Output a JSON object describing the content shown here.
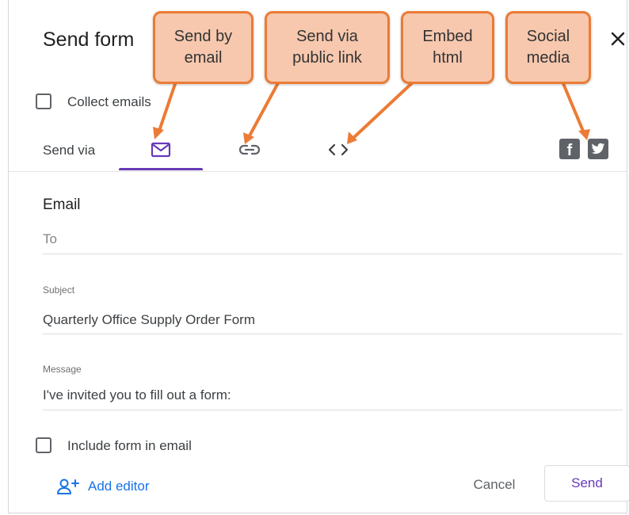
{
  "dialog": {
    "title": "Send form",
    "collect_emails": {
      "label": "Collect emails",
      "checked": false
    },
    "send_via": {
      "label": "Send via",
      "active_tab": "email",
      "active_color": "#673ab7",
      "tabs": [
        {
          "id": "email",
          "icon": "mail-icon"
        },
        {
          "id": "link",
          "icon": "link-icon"
        },
        {
          "id": "embed",
          "icon": "code-icon"
        }
      ],
      "social": [
        {
          "id": "facebook",
          "icon": "facebook-icon",
          "glyph": "f"
        },
        {
          "id": "twitter",
          "icon": "twitter-icon"
        }
      ]
    },
    "email_section": {
      "title": "Email",
      "to": {
        "placeholder": "To",
        "value": ""
      },
      "subject": {
        "label": "Subject",
        "value": "Quarterly Office Supply Order Form"
      },
      "message": {
        "label": "Message",
        "value": "I've invited you to fill out a form:"
      },
      "include_form": {
        "label": "Include form in email",
        "checked": false
      }
    },
    "footer": {
      "add_editor": "Add editor",
      "cancel": "Cancel",
      "send": "Send"
    }
  },
  "annotations": {
    "color": "#ec7b35",
    "fill": "#f7c8ae",
    "callouts": [
      {
        "id": "email",
        "lines": [
          "Send by",
          "email"
        ]
      },
      {
        "id": "link",
        "lines": [
          "Send via",
          "public link"
        ]
      },
      {
        "id": "embed",
        "lines": [
          "Embed",
          "html"
        ]
      },
      {
        "id": "social",
        "lines": [
          "Social",
          "media"
        ]
      }
    ]
  }
}
